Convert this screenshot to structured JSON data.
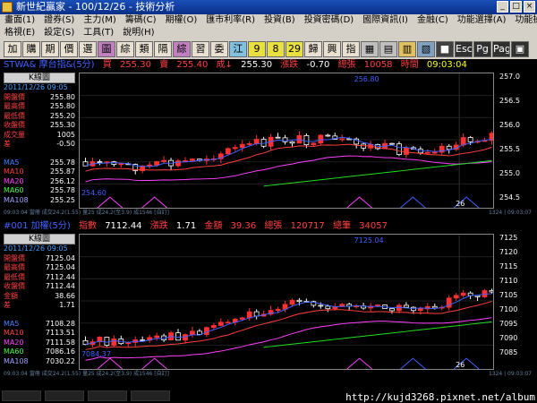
{
  "window": {
    "title": "新世紀贏家 - 100/12/26 - 技術分析"
  },
  "menu1": [
    "畫面(1)",
    "證券(S)",
    "主力(M)",
    "籌碼(C)",
    "期權(O)",
    "匯市利率(R)",
    "投資(B)",
    "投資密碼(D)",
    "國際資訊(I)",
    "金融(C)",
    "功能選擇(A)",
    "功能操作(K)"
  ],
  "menu2": [
    "格視(E)",
    "設定(S)",
    "工具(T)",
    "說明(H)"
  ],
  "toolbar": [
    {
      "label": "加",
      "color": "#e8e0d0"
    },
    {
      "label": "購",
      "color": "#e8e0d0"
    },
    {
      "label": "期",
      "color": "#e8e0d0"
    },
    {
      "label": "價",
      "color": "#e8e0d0"
    },
    {
      "label": "選",
      "color": "#e8e0d0"
    },
    {
      "label": "圖",
      "color": "#c080c0"
    },
    {
      "label": "綜",
      "color": "#e8e0d0"
    },
    {
      "label": "類",
      "color": "#e8e0d0"
    },
    {
      "label": "隔",
      "color": "#e8e0d0"
    },
    {
      "label": "綜",
      "color": "#c080c0"
    },
    {
      "label": "習",
      "color": "#e8e0d0"
    },
    {
      "label": "委",
      "color": "#e8e0d0"
    },
    {
      "label": "江",
      "color": "#80c0e0"
    },
    {
      "label": "9",
      "color": "#e8e040"
    },
    {
      "label": "8",
      "color": "#e8e040"
    },
    {
      "label": "29",
      "color": "#e8e040"
    },
    {
      "label": "歸",
      "color": "#e8e0d0"
    },
    {
      "label": "興",
      "color": "#e8e0d0"
    },
    {
      "label": "指",
      "color": "#e8e0d0"
    },
    {
      "label": "▦",
      "color": "#c0c0c0"
    },
    {
      "label": "▤",
      "color": "#c0c0c0"
    },
    {
      "label": "▥",
      "color": "#e0c060"
    },
    {
      "label": "▧",
      "color": "#80a0c0"
    },
    {
      "label": "■",
      "color": "#404040"
    },
    {
      "label": "Esc",
      "color": "#303030"
    },
    {
      "label": "Pg",
      "color": "#303030"
    },
    {
      "label": "Page",
      "color": "#303030"
    },
    {
      "label": "▣",
      "color": "#303030"
    }
  ],
  "panel1": {
    "symbol": "STWA& 摩台指&(5分)",
    "buy_label": "買",
    "buy": "255.30",
    "sell_label": "賣",
    "sell": "255.40",
    "deal_label": "成↓",
    "deal": "255.30",
    "chg_label": "漲跌",
    "chg": "-0.70",
    "vol_label": "總張",
    "vol": "10058",
    "time_label": "時間",
    "time": "09:03:04",
    "k_title": "K線圖",
    "date": "2011/12/26 09:05",
    "rows": [
      {
        "label": "開盤價",
        "value": "255.80",
        "color": "#ff4040"
      },
      {
        "label": "最高價",
        "value": "255.80",
        "color": "#ff4040"
      },
      {
        "label": "最低價",
        "value": "255.20",
        "color": "#ff4040"
      },
      {
        "label": "收盤價",
        "value": "255.30",
        "color": "#ff4040"
      },
      {
        "label": "成交量",
        "value": "1005",
        "color": "#ff4040"
      },
      {
        "label": "差",
        "value": "-0.50",
        "color": "#ff4040"
      }
    ],
    "ma": [
      {
        "label": "MA5",
        "value": "255.78",
        "color": "#4080ff"
      },
      {
        "label": "MA10",
        "value": "255.87",
        "color": "#ff4040"
      },
      {
        "label": "MA20",
        "value": "256.12",
        "color": "#ff40ff"
      },
      {
        "label": "MA60",
        "value": "255.78",
        "color": "#40ff40"
      },
      {
        "label": "MA108",
        "value": "255.25",
        "color": "#a0a0ff"
      }
    ],
    "yticks": [
      "257.0",
      "256.5",
      "256.0",
      "255.5",
      "255.0",
      "254.5"
    ],
    "high_mark": "256.80",
    "low_mark": "254.60",
    "xmark": "26",
    "status": "09:03:04 當冊 成交24.2(1.55) 量25 成24.2(至3.9) 成1546 [自訂]",
    "status_right": "1324 | 09:03:07"
  },
  "panel2": {
    "symbol": "#001 加權(5分)",
    "idx_label": "指數",
    "idx": "7112.44",
    "chg_label": "漲跌",
    "chg": "1.71",
    "amt_label": "金額",
    "amt": "39.36",
    "vol_label": "總張",
    "vol": "120717",
    "cnt_label": "總筆",
    "cnt": "34057",
    "k_title": "K線圖",
    "date": "2011/12/26 09:05",
    "rows": [
      {
        "label": "開盤價",
        "value": "7125.04",
        "color": "#ff4040"
      },
      {
        "label": "最高價",
        "value": "7125.04",
        "color": "#ff4040"
      },
      {
        "label": "最低價",
        "value": "7112.44",
        "color": "#ff4040"
      },
      {
        "label": "收盤價",
        "value": "7112.44",
        "color": "#ff4040"
      },
      {
        "label": "金額",
        "value": "38.66",
        "color": "#ff4040"
      },
      {
        "label": "差",
        "value": "1.71",
        "color": "#ff4040"
      }
    ],
    "ma": [
      {
        "label": "MA5",
        "value": "7108.28",
        "color": "#4080ff"
      },
      {
        "label": "MA10",
        "value": "7113.51",
        "color": "#ff4040"
      },
      {
        "label": "MA20",
        "value": "7111.58",
        "color": "#ff40ff"
      },
      {
        "label": "MA60",
        "value": "7086.16",
        "color": "#40ff40"
      },
      {
        "label": "MA108",
        "value": "7030.22",
        "color": "#a0a0ff"
      }
    ],
    "yticks": [
      "7125",
      "7120",
      "7115",
      "7110",
      "7105",
      "7100",
      "7095",
      "7090",
      "7085"
    ],
    "high_mark": "7125.04",
    "low_mark": "7084.37",
    "xmark": "26",
    "status": "09:03:04 當冊 成交24.2(1.55) 量25 成24.2(至3.9) 成1546 [自訂]",
    "status_right": "1324 | 09:03:07"
  },
  "watermark": "http://kujd3268.pixnet.net/album",
  "colors": {
    "up": "#ff3030",
    "down": "#ffffff",
    "ma5": "#4060ff",
    "ma10": "#ff4040",
    "ma20": "#ff40ff",
    "ma60": "#20e020"
  }
}
